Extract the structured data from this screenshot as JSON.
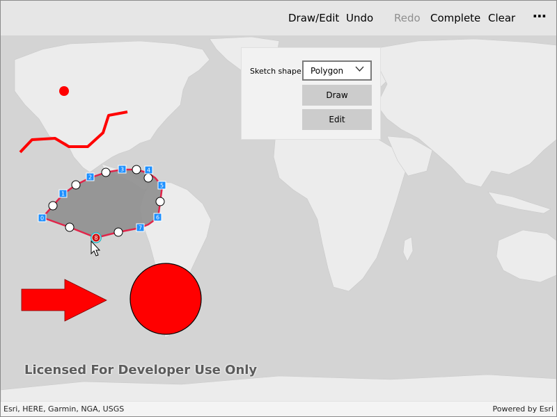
{
  "toolbar": {
    "draw_edit": "Draw/Edit",
    "undo": "Undo",
    "redo": "Redo",
    "complete": "Complete",
    "clear": "Clear",
    "more": "⋯"
  },
  "panel": {
    "shape_label": "Sketch shape:",
    "shape_value": "Polygon",
    "draw_button": "Draw",
    "edit_button": "Edit"
  },
  "map": {
    "license_text": "Licensed For Developer Use Only",
    "vertex_labels": [
      "0",
      "1",
      "2",
      "3",
      "4",
      "5",
      "6",
      "7",
      "8"
    ],
    "graphics_color": "#ff0000",
    "sketch_outline_color": "#e0254a",
    "selected_vertex_ring": "#2fb7c4"
  },
  "attribution": {
    "sources": "Esri, HERE, Garmin, NGA, USGS",
    "powered_by": "Powered by Esri"
  }
}
